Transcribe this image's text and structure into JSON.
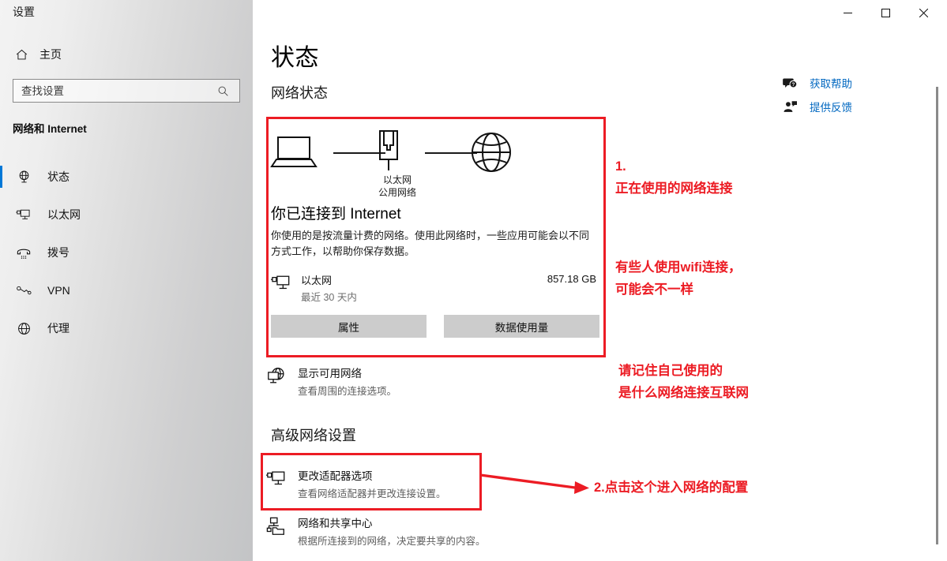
{
  "window": {
    "title": "设置",
    "controls": [
      {
        "name": "minimize",
        "glyph": "—"
      },
      {
        "name": "maximize",
        "glyph": "▢"
      },
      {
        "name": "close",
        "glyph": "✕"
      }
    ]
  },
  "sidebar": {
    "home_label": "主页",
    "home_icon": "home-icon",
    "search": {
      "placeholder": "查找设置",
      "value": "",
      "icon": "search-icon"
    },
    "category": "网络和 Internet",
    "items": [
      {
        "label": "状态",
        "icon": "globe-stand-icon",
        "selected": true
      },
      {
        "label": "以太网",
        "icon": "monitor-plug-icon",
        "selected": false
      },
      {
        "label": "拨号",
        "icon": "dialup-phone-icon",
        "selected": false
      },
      {
        "label": "VPN",
        "icon": "vpn-key-icon",
        "selected": false
      },
      {
        "label": "代理",
        "icon": "globe-icon",
        "selected": false
      }
    ],
    "selection_color": "#0078d7"
  },
  "main": {
    "page_title": "状态",
    "section_network_status": "网络状态",
    "section_advanced": "高级网络设置",
    "help_links": [
      {
        "label": "获取帮助",
        "icon": "help-question-bubble-icon"
      },
      {
        "label": "提供反馈",
        "icon": "feedback-person-icon"
      }
    ],
    "status_card": {
      "diagram": {
        "device_icon": "laptop-icon",
        "adapter_icon": "ethernet-port-icon",
        "internet_icon": "globe-icon",
        "caption_line1": "以太网",
        "caption_line2": "公用网络"
      },
      "connected_title": "你已连接到 Internet",
      "connected_desc": "你使用的是按流量计费的网络。使用此网络时，一些应用可能会以不同方式工作，以帮助你保存数据。",
      "adapter": {
        "icon": "monitor-plug-icon",
        "name": "以太网",
        "subtitle": "最近 30 天内",
        "usage": "857.18 GB"
      },
      "buttons": [
        {
          "label": "属性",
          "name": "properties-button"
        },
        {
          "label": "数据使用量",
          "name": "data-usage-button"
        }
      ]
    },
    "rows": [
      {
        "name": "show-available-networks",
        "icon": "globe-monitor-icon",
        "title": "显示可用网络",
        "subtitle": "查看周围的连接选项。"
      },
      {
        "name": "change-adapter-options",
        "icon": "monitor-plug-icon",
        "title": "更改适配器选项",
        "subtitle": "查看网络适配器并更改连接设置。"
      },
      {
        "name": "network-sharing-center",
        "icon": "network-sharing-icon",
        "title": "网络和共享中心",
        "subtitle": "根据所连接到的网络，决定要共享的内容。"
      }
    ]
  },
  "annotations": {
    "color": "#ec1c24",
    "note1": "1.\n正在使用的网络连接",
    "note2": "有些人使用wifi连接，\n可能会不一样",
    "note3": "请记住自己使用的\n是什么网络连接互联网",
    "note4": "2.点击这个进入网络的配置"
  }
}
